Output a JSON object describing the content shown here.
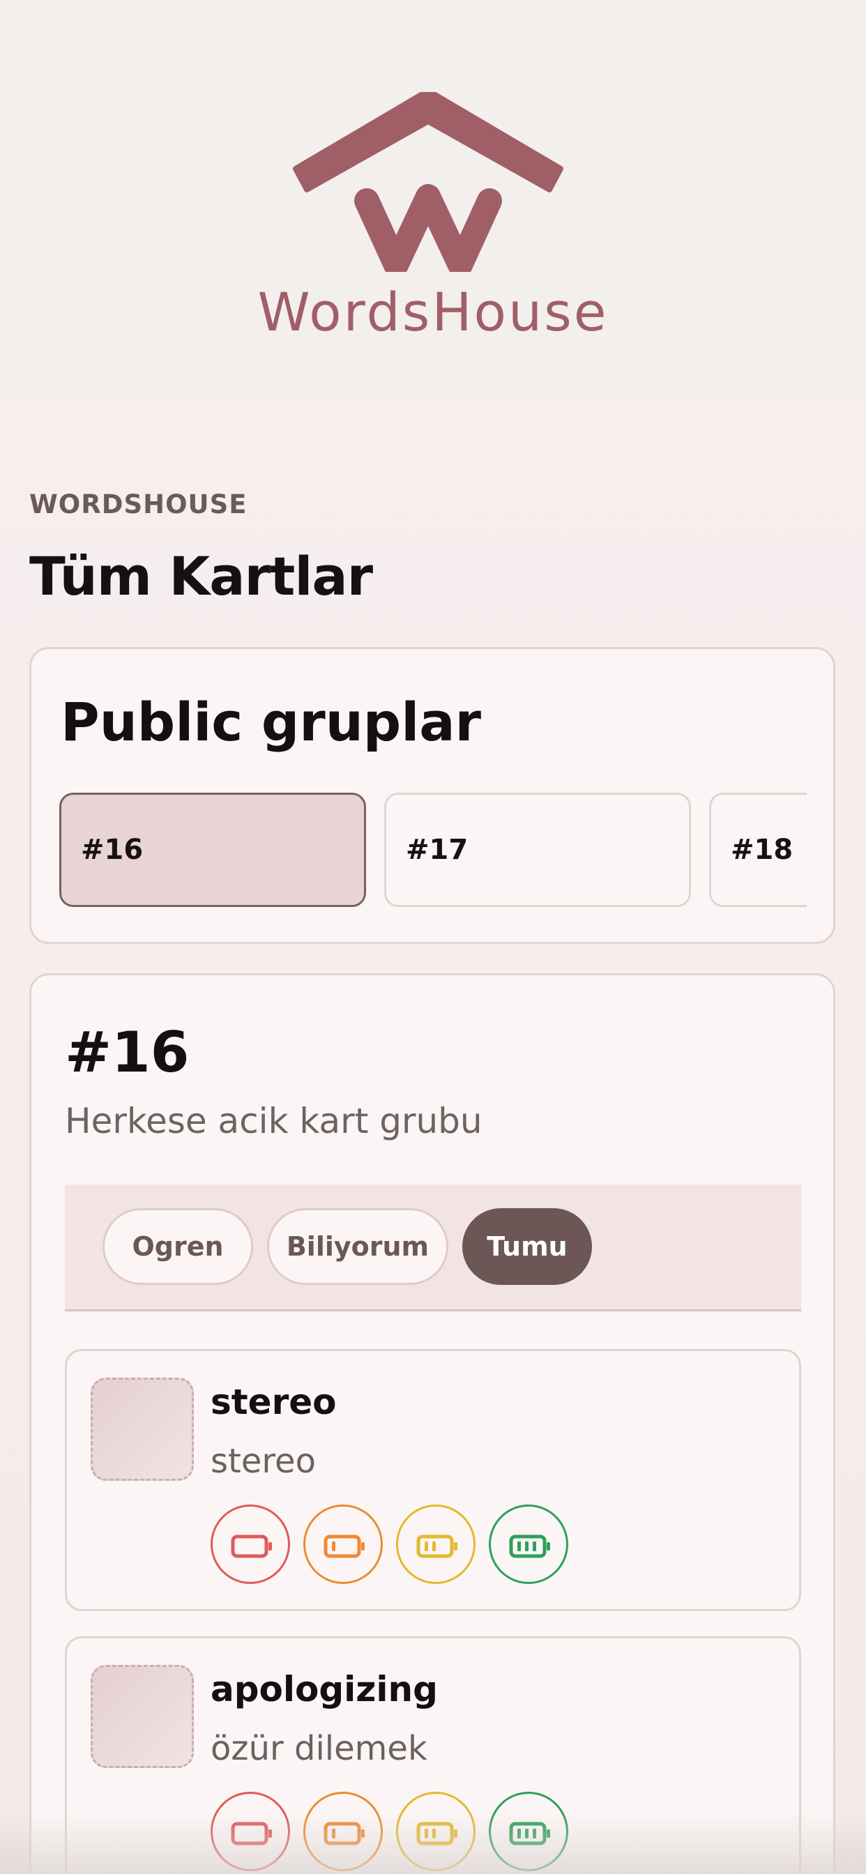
{
  "brand": {
    "name": "WordsHouse",
    "logo_icon": "house-w-logo-icon",
    "color": "#a05f66"
  },
  "overline": "WORDSHOUSE",
  "page_title": "Tüm Kartlar",
  "groups": {
    "title": "Public gruplar",
    "items": [
      {
        "label": "#16",
        "active": true
      },
      {
        "label": "#17",
        "active": false
      },
      {
        "label": "#18",
        "active": false
      }
    ]
  },
  "detail": {
    "title": "#16",
    "subtitle": "Herkese acik kart grubu",
    "filters": [
      {
        "label": "Ogren",
        "active": false
      },
      {
        "label": "Biliyorum",
        "active": false
      },
      {
        "label": "Tumu",
        "active": true
      }
    ],
    "cards": [
      {
        "word": "stereo",
        "meaning": "stereo"
      },
      {
        "word": "apologizing",
        "meaning": "özür dilemek"
      }
    ]
  },
  "levels": [
    {
      "icon": "battery-empty-icon",
      "color": "#e05a5a"
    },
    {
      "icon": "battery-low-icon",
      "color": "#ef8a32"
    },
    {
      "icon": "battery-medium-icon",
      "color": "#e3b92e"
    },
    {
      "icon": "battery-full-icon",
      "color": "#2ea05a"
    }
  ]
}
